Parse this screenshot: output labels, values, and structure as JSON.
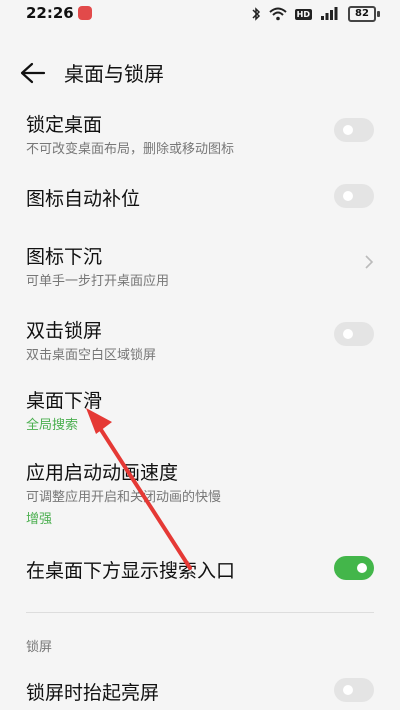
{
  "status": {
    "time": "22:26",
    "hd_label": "HD",
    "battery": "82"
  },
  "header": {
    "title": "桌面与锁屏"
  },
  "items": [
    {
      "title": "锁定桌面",
      "subtitle": "不可改变桌面布局，删除或移动图标",
      "control": "toggle",
      "on": false
    },
    {
      "title": "图标自动补位",
      "control": "toggle",
      "on": false
    },
    {
      "title": "图标下沉",
      "subtitle": "可单手一步打开桌面应用",
      "control": "chevron"
    },
    {
      "title": "双击锁屏",
      "subtitle": "双击桌面空白区域锁屏",
      "control": "toggle",
      "on": false
    },
    {
      "title": "桌面下滑",
      "value": "全局搜索"
    },
    {
      "title": "应用启动动画速度",
      "subtitle": "可调整应用开启和关闭动画的快慢",
      "value": "增强"
    },
    {
      "title": "在桌面下方显示搜索入口",
      "control": "toggle",
      "on": true
    }
  ],
  "lock_section": {
    "title": "锁屏",
    "items": [
      {
        "title": "锁屏时抬起亮屏",
        "control": "toggle",
        "on": false
      }
    ]
  },
  "colors": {
    "accent": "#43b64a",
    "annotation": "#e53935"
  }
}
